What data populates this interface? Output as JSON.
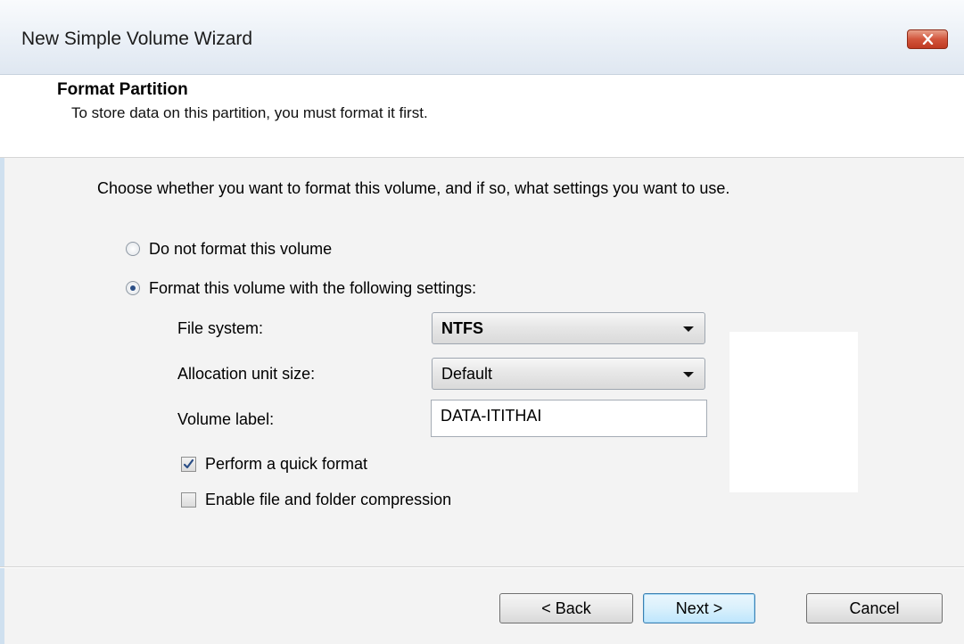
{
  "window": {
    "title": "New Simple Volume Wizard",
    "close_icon": "close-icon"
  },
  "header": {
    "title": "Format Partition",
    "subtitle": "To store data on this partition, you must format it first."
  },
  "main": {
    "intro": "Choose whether you want to format this volume, and if so, what settings you want to use.",
    "options": [
      {
        "label": "Do not format this volume",
        "selected": false
      },
      {
        "label": "Format this volume with the following settings:",
        "selected": true
      }
    ],
    "fields": {
      "file_system": {
        "label": "File system:",
        "value": "NTFS"
      },
      "allocation_unit_size": {
        "label": "Allocation unit size:",
        "value": "Default"
      },
      "volume_label": {
        "label": "Volume label:",
        "value": "DATA-ITITHAI"
      }
    },
    "checkboxes": [
      {
        "label": "Perform a quick format",
        "checked": true
      },
      {
        "label": "Enable file and folder compression",
        "checked": false
      }
    ]
  },
  "footer": {
    "back_label": "< Back",
    "next_label": "Next >",
    "cancel_label": "Cancel"
  },
  "colors": {
    "close_button": "#c9452c",
    "primary_button_border": "#3c7fb1",
    "header_bg": "#ffffff",
    "body_bg": "#f3f3f3"
  }
}
